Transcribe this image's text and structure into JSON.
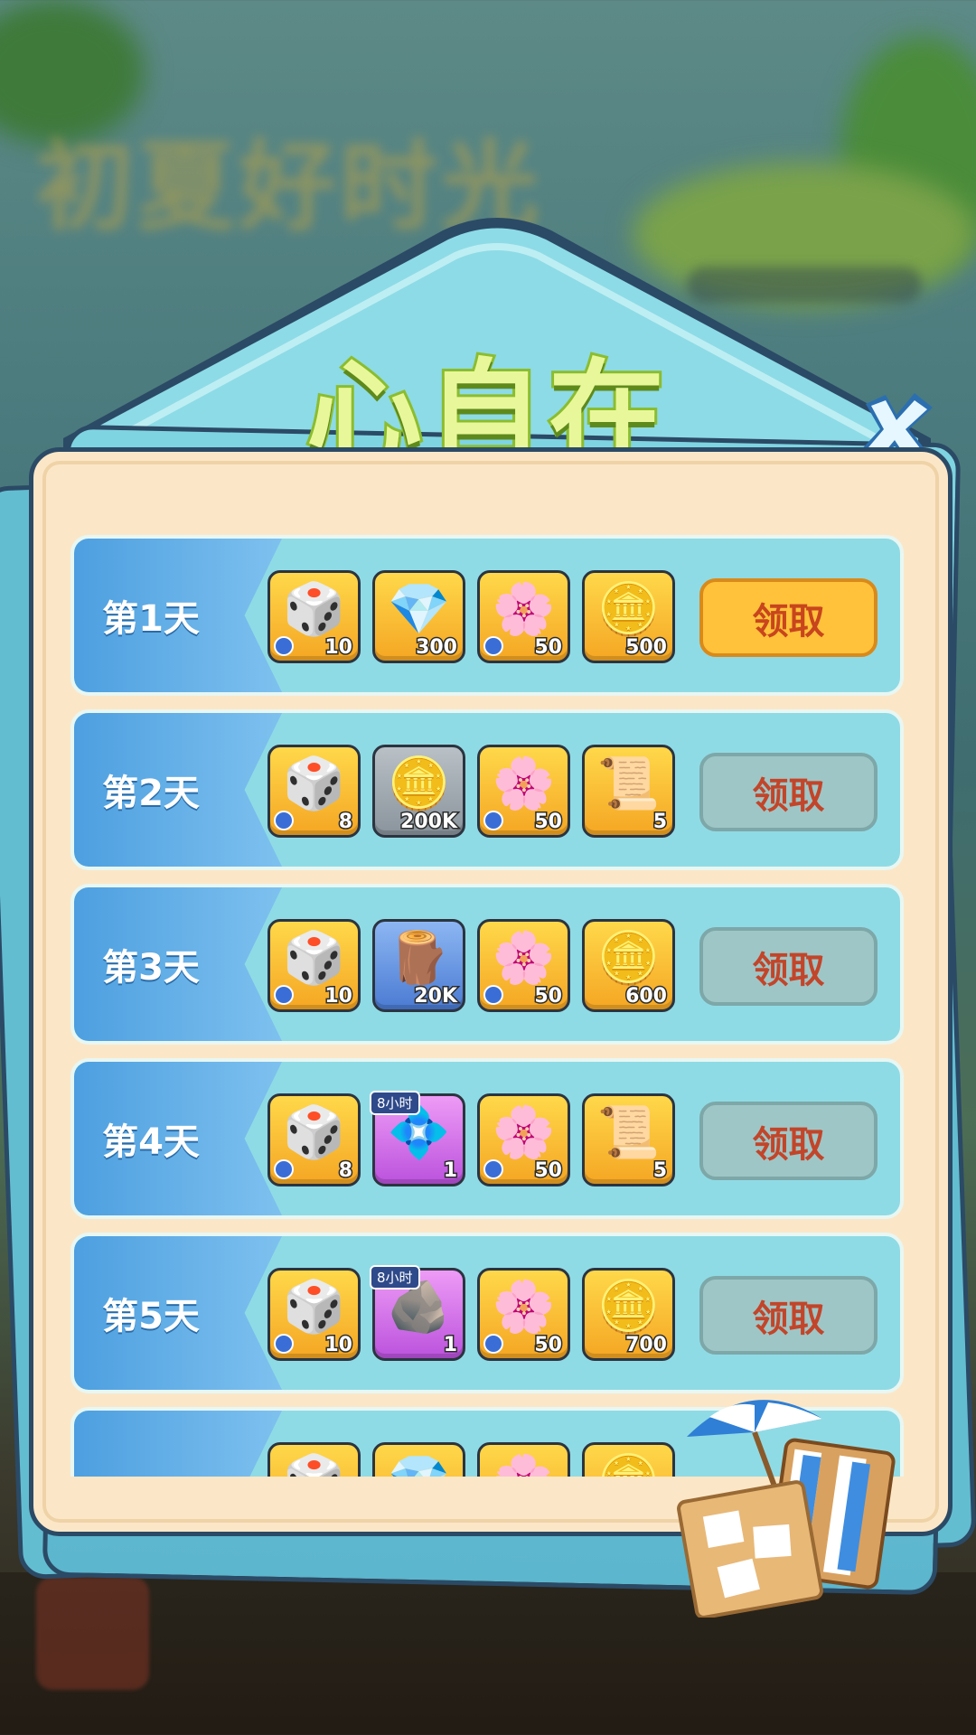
{
  "background": {
    "event_title": "初夏好时光"
  },
  "panel": {
    "title": "心自在",
    "claim_label": "领取"
  },
  "rows": [
    {
      "day": "第1天",
      "claim_state": "active",
      "items": [
        {
          "icon": "dice-icon",
          "glyph": "🎲",
          "qty": "10",
          "bg": "yellow",
          "timed": true
        },
        {
          "icon": "gem-icon",
          "glyph": "💎",
          "qty": "300",
          "bg": "yellow",
          "timed": false
        },
        {
          "icon": "blossom-icon",
          "glyph": "🌸",
          "qty": "50",
          "bg": "yellow",
          "timed": true
        },
        {
          "icon": "lotus-coin-icon",
          "glyph": "🪙",
          "qty": "500",
          "bg": "yellow",
          "timed": false
        }
      ]
    },
    {
      "day": "第2天",
      "claim_state": "disabled",
      "items": [
        {
          "icon": "dice-icon",
          "glyph": "🎲",
          "qty": "8",
          "bg": "yellow",
          "timed": true
        },
        {
          "icon": "coin-icon",
          "glyph": "🪙",
          "qty": "200K",
          "bg": "grey",
          "timed": false
        },
        {
          "icon": "blossom-icon",
          "glyph": "🌸",
          "qty": "50",
          "bg": "yellow",
          "timed": true
        },
        {
          "icon": "scroll-icon",
          "glyph": "📜",
          "qty": "5",
          "bg": "yellow",
          "timed": false
        }
      ]
    },
    {
      "day": "第3天",
      "claim_state": "disabled",
      "items": [
        {
          "icon": "dice-icon",
          "glyph": "🎲",
          "qty": "10",
          "bg": "yellow",
          "timed": true
        },
        {
          "icon": "wood-icon",
          "glyph": "🪵",
          "qty": "20K",
          "bg": "blue",
          "timed": false
        },
        {
          "icon": "blossom-icon",
          "glyph": "🌸",
          "qty": "50",
          "bg": "yellow",
          "timed": true
        },
        {
          "icon": "lotus-coin-icon",
          "glyph": "🪙",
          "qty": "600",
          "bg": "yellow",
          "timed": false
        }
      ]
    },
    {
      "day": "第4天",
      "claim_state": "disabled",
      "items": [
        {
          "icon": "dice-icon",
          "glyph": "🎲",
          "qty": "8",
          "bg": "yellow",
          "timed": true
        },
        {
          "icon": "crystal-stones-icon",
          "glyph": "💠",
          "qty": "1",
          "bg": "purple",
          "timed": false,
          "tag": "8小时"
        },
        {
          "icon": "blossom-icon",
          "glyph": "🌸",
          "qty": "50",
          "bg": "yellow",
          "timed": true
        },
        {
          "icon": "scroll-icon",
          "glyph": "📜",
          "qty": "5",
          "bg": "yellow",
          "timed": false
        }
      ]
    },
    {
      "day": "第5天",
      "claim_state": "disabled",
      "items": [
        {
          "icon": "dice-icon",
          "glyph": "🎲",
          "qty": "10",
          "bg": "yellow",
          "timed": true
        },
        {
          "icon": "ore-icon",
          "glyph": "🪨",
          "qty": "1",
          "bg": "purple",
          "timed": false,
          "tag": "8小时"
        },
        {
          "icon": "blossom-icon",
          "glyph": "🌸",
          "qty": "50",
          "bg": "yellow",
          "timed": true
        },
        {
          "icon": "lotus-coin-icon",
          "glyph": "🪙",
          "qty": "700",
          "bg": "yellow",
          "timed": false
        }
      ]
    },
    {
      "day": "",
      "claim_state": "hidden",
      "items": [
        {
          "icon": "dice-icon",
          "glyph": "🎲",
          "qty": "",
          "bg": "yellow",
          "timed": false
        },
        {
          "icon": "gem-icon",
          "glyph": "💎",
          "qty": "",
          "bg": "yellow",
          "timed": false
        },
        {
          "icon": "blossom-icon",
          "glyph": "🌸",
          "qty": "",
          "bg": "yellow",
          "timed": false
        },
        {
          "icon": "lotus-coin-icon",
          "glyph": "🪙",
          "qty": "",
          "bg": "yellow",
          "timed": false
        }
      ]
    }
  ],
  "colors": {
    "active_button": "#ffc23a",
    "disabled_button": "#9fc6c6",
    "title_fill": "#e9f79b",
    "row_bg": "#8fdbe5"
  }
}
